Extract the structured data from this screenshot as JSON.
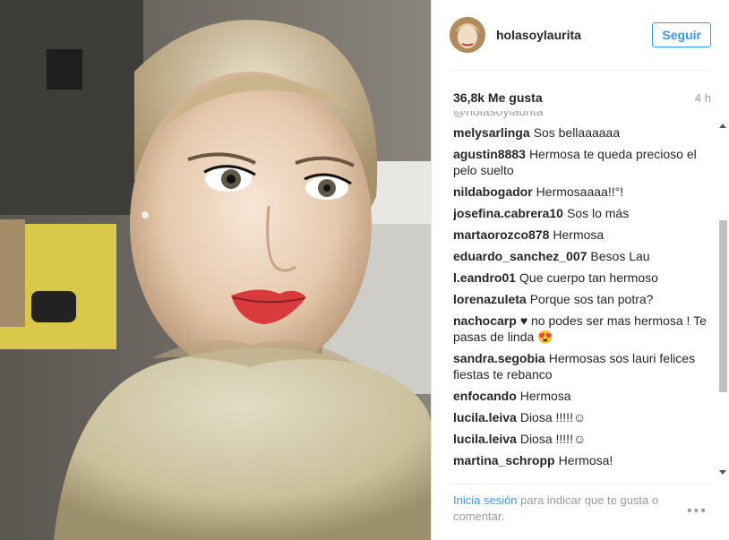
{
  "post": {
    "username": "holasoylaurita",
    "follow_label": "Seguir",
    "likes": "36,8k Me gusta",
    "time": "4 h",
    "partial_top_comment": "@holasoylaurita",
    "comments": [
      {
        "user": "melysarlinga",
        "text": "Sos bellaaaaaa"
      },
      {
        "user": "agustin8883",
        "text": "Hermosa te queda precioso el pelo suelto"
      },
      {
        "user": "nildabogador",
        "text": "Hermosaaaa!!°!"
      },
      {
        "user": "josefina.cabrera10",
        "text": "Sos lo más"
      },
      {
        "user": "martaorozco878",
        "text": "Hermosa"
      },
      {
        "user": "eduardo_sanchez_007",
        "text": "Besos Lau"
      },
      {
        "user": "l.eandro01",
        "text": "Que cuerpo tan hermoso"
      },
      {
        "user": "lorenazuleta",
        "text": "Porque sos tan potra?"
      },
      {
        "user": "nachocarp",
        "text": "♥ no podes ser mas hermosa ! Te pasas de linda 😍"
      },
      {
        "user": "sandra.segobia",
        "text": "Hermosas sos lauri felices fiestas te rebanco"
      },
      {
        "user": "enfocando",
        "text": "Hermosa"
      },
      {
        "user": "lucila.leiva",
        "text": "Diosa !!!!!☺"
      },
      {
        "user": "lucila.leiva",
        "text": "Diosa !!!!!☺"
      },
      {
        "user": "martina_schropp",
        "text": "Hermosa!"
      }
    ],
    "login_link": "Inicia sesión",
    "login_text": " para indicar que te gusta o comentar.",
    "more_label": "•••"
  }
}
